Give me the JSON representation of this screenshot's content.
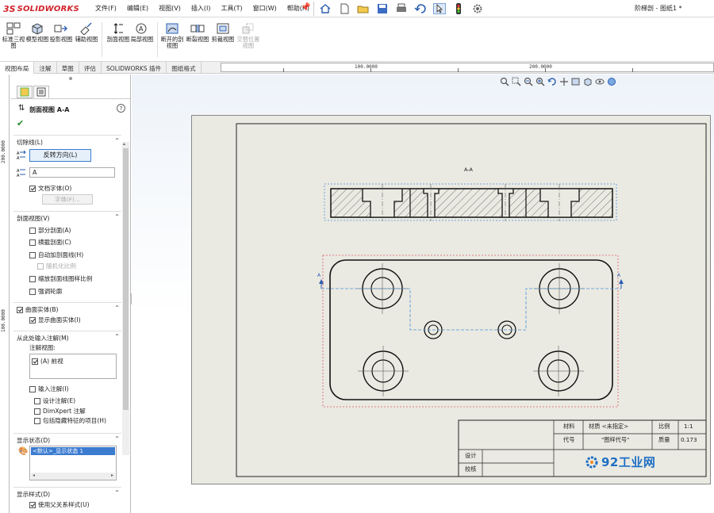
{
  "app": {
    "logo_ds": "3S",
    "logo_name": "SOLIDWORKS",
    "window_title": "阶梯剖 - 图纸1 *",
    "menus": [
      "文件(F)",
      "编辑(E)",
      "视图(V)",
      "插入(I)",
      "工具(T)",
      "窗口(W)",
      "帮助(H)"
    ]
  },
  "ribbon": {
    "buttons": [
      {
        "label": "标准三视图",
        "enabled": true
      },
      {
        "label": "模型视图",
        "enabled": true
      },
      {
        "label": "投影视图",
        "enabled": true
      },
      {
        "label": "辅助视图",
        "enabled": true
      },
      {
        "label": "剖面视图",
        "enabled": true
      },
      {
        "label": "局部视图",
        "enabled": true
      },
      {
        "label": "断开的剖视图",
        "enabled": true
      },
      {
        "label": "断裂视图",
        "enabled": true
      },
      {
        "label": "剪裁视图",
        "enabled": true
      },
      {
        "label": "交替位置视图",
        "enabled": false
      }
    ]
  },
  "tabs": [
    "视图布局",
    "注解",
    "草图",
    "评估",
    "SOLIDWORKS 插件",
    "图纸格式"
  ],
  "rulers": {
    "top": [
      "100.0000",
      "200.0000"
    ],
    "left": [
      "200.0000",
      "100.0000"
    ]
  },
  "panel": {
    "title": "剖面视图 A-A",
    "help": "?",
    "cutline": {
      "header": "切除线(L)",
      "flip_button": "反转方向(L)",
      "label_value": "A",
      "doc_font": "文档字体(O)",
      "font_button": "字体(F)..."
    },
    "section_view": {
      "header": "剖面视图(V)",
      "items": [
        {
          "label": "部分剖面(A)",
          "checked": false,
          "enabled": true
        },
        {
          "label": "横截剖面(C)",
          "checked": false,
          "enabled": true
        },
        {
          "label": "自动加剖面线(H)",
          "checked": false,
          "enabled": true
        },
        {
          "label": "随机化比例",
          "checked": false,
          "enabled": false
        },
        {
          "label": "缩放剖面线图样比例",
          "checked": false,
          "enabled": true
        },
        {
          "label": "强调轮廓",
          "checked": false,
          "enabled": true
        }
      ]
    },
    "surface_bodies": {
      "header": "曲面实体(B)",
      "item": "显示曲面实体(I)"
    },
    "import_annotations": {
      "header": "从此处输入注解(M)",
      "annot_views_label": "注解视图:",
      "annot_view_item": "(A) 前视",
      "import_label": "输入注解(I)",
      "sub_items": [
        "设计注解(E)",
        "DimXpert 注解",
        "包括隐藏特征的项目(H)"
      ]
    },
    "display_state": {
      "header": "显示状态(D)",
      "selected": "<默认>_显示状态 1"
    },
    "display_style": {
      "header": "显示样式(D)",
      "item": "使用父关系样式(U)"
    }
  },
  "drawing": {
    "section_label": "A-A",
    "cut_arrow_label": "A",
    "title_block": {
      "material_label": "材料",
      "material_value": "材质 <未指定>",
      "scale_label": "比例",
      "scale_value": "1:1",
      "code_label": "代号",
      "code_value": "\"图样代号\"",
      "mass_label": "质量",
      "mass_value": "0.173",
      "design_label": "设计",
      "check_label": "校核",
      "watermark": "92工业网"
    }
  },
  "colors": {
    "accent": "#2a5db0",
    "sheet": "#eaeae2",
    "preview_box": "#e05a6a",
    "view_box": "#4a8fd8",
    "watermark": "#1f6fc4",
    "ok": "#2a8a2a"
  }
}
